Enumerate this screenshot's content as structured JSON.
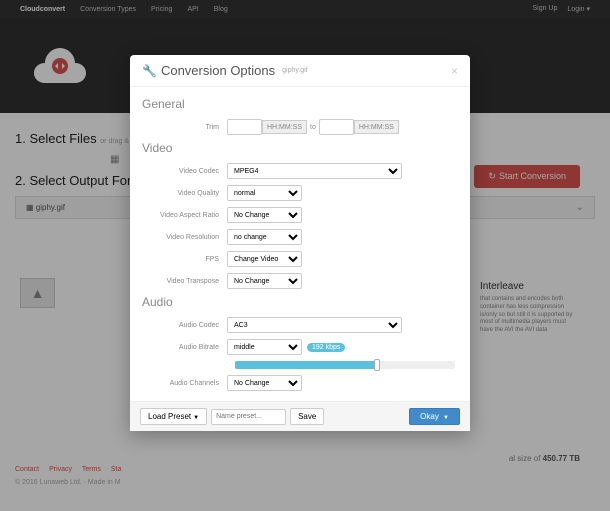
{
  "topbar": {
    "brand": "Cloudconvert",
    "links": [
      "Conversion Types",
      "Pricing",
      "API",
      "Blog"
    ],
    "right": [
      "Sign Up",
      "Login ▾"
    ]
  },
  "page": {
    "step1": "1. Select Files",
    "step1_hint": "or drag &",
    "step2": "2. Select Output For f",
    "filename": "▦ giphy.gif",
    "convert_btn": "Start Conversion"
  },
  "info": {
    "right_heading": "Interleave",
    "right_body": "that contains and encodes both container has less compression is/only so but still it is supported by most of multimedia players must have the AVI the AVI data"
  },
  "modal": {
    "title": "Conversion Options",
    "subtitle": "giphy.gif",
    "sections": {
      "general": "General",
      "video": "Video",
      "audio": "Audio"
    },
    "labels": {
      "trim": "Trim",
      "to": "to",
      "time_ph": "HH:MM:SS",
      "video_codec": "Video Codec",
      "video_quality": "Video Quality",
      "video_aspect": "Video Aspect Ratio",
      "video_resolution": "Video Resolution",
      "fps": "FPS",
      "video_transpose": "Video Transpose",
      "audio_codec": "Audio Codec",
      "audio_bitrate": "Audio Bitrate",
      "audio_channels": "Audio Channels"
    },
    "values": {
      "video_codec": "MPEG4",
      "video_quality": "normal",
      "video_aspect": "No Change",
      "video_resolution": "no change",
      "fps_option": "Change Video",
      "video_transpose": "No Change",
      "audio_codec": "AC3",
      "audio_bitrate": "middle",
      "audio_bitrate_badge": "192 kbps",
      "audio_channels": "No Change"
    },
    "footer": {
      "load_preset": "Load Preset",
      "name_preset_ph": "Name preset...",
      "save": "Save",
      "okay": "Okay"
    }
  },
  "footer": {
    "links": [
      "Contact",
      "Privacy",
      "Terms",
      "Sta"
    ],
    "copyright": "© 2016 Lunaweb Ltd. · Made in M",
    "total_prefix": "al size of ",
    "total_value": "450.77 TB"
  }
}
